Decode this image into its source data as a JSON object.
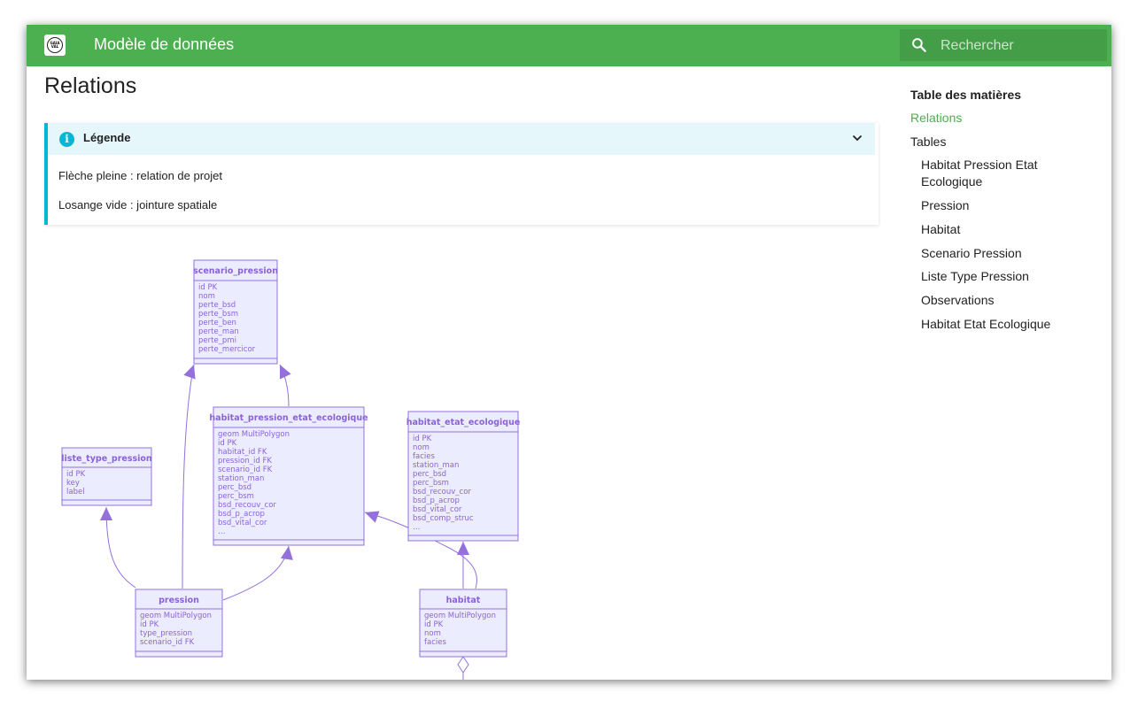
{
  "header": {
    "logo_alt": "Gaia Valley logo",
    "title": "Modèle de données",
    "search_placeholder": "Rechercher"
  },
  "page": {
    "title": "Relations"
  },
  "legend": {
    "title": "Légende",
    "lines": [
      "Flèche pleine : relation de projet",
      "Losange vide : jointure spatiale"
    ]
  },
  "toc": {
    "title": "Table des matières",
    "items": [
      {
        "label": "Relations",
        "active": true,
        "level": 0
      },
      {
        "label": "Tables",
        "active": false,
        "level": 0
      },
      {
        "label": "Habitat Pression Etat Ecologique",
        "active": false,
        "level": 1
      },
      {
        "label": "Pression",
        "active": false,
        "level": 1
      },
      {
        "label": "Habitat",
        "active": false,
        "level": 1
      },
      {
        "label": "Scenario Pression",
        "active": false,
        "level": 1
      },
      {
        "label": "Liste Type Pression",
        "active": false,
        "level": 1
      },
      {
        "label": "Observations",
        "active": false,
        "level": 1
      },
      {
        "label": "Habitat Etat Ecologique",
        "active": false,
        "level": 1
      }
    ]
  },
  "diagram": {
    "colors": {
      "header": "#4caf50",
      "entity_fill": "#ececff",
      "entity_stroke": "#9370db",
      "text": "#8a62d6",
      "info": "#00b8d4"
    },
    "entities": [
      {
        "id": "scenario_pression",
        "name": "scenario_pression",
        "attributes": [
          "id PK",
          "nom",
          "perte_bsd",
          "perte_bsm",
          "perte_ben",
          "perte_man",
          "perte_pmi",
          "perte_mercicor"
        ]
      },
      {
        "id": "habitat_pression_etat_ecologique",
        "name": "habitat_pression_etat_ecologique",
        "attributes": [
          "geom MultiPolygon",
          "id PK",
          "habitat_id FK",
          "pression_id FK",
          "scenario_id FK",
          "station_man",
          "perc_bsd",
          "perc_bsm",
          "bsd_recouv_cor",
          "bsd_p_acrop",
          "bsd_vital_cor",
          "..."
        ]
      },
      {
        "id": "habitat_etat_ecologique",
        "name": "habitat_etat_ecologique",
        "attributes": [
          "id PK",
          "nom",
          "facies",
          "station_man",
          "perc_bsd",
          "perc_bsm",
          "bsd_recouv_cor",
          "bsd_p_acrop",
          "bsd_vital_cor",
          "bsd_comp_struc",
          "..."
        ]
      },
      {
        "id": "liste_type_pression",
        "name": "liste_type_pression",
        "attributes": [
          "id PK",
          "key",
          "label"
        ]
      },
      {
        "id": "pression",
        "name": "pression",
        "attributes": [
          "geom MultiPolygon",
          "id PK",
          "type_pression",
          "scenario_id FK"
        ]
      },
      {
        "id": "habitat",
        "name": "habitat",
        "attributes": [
          "geom MultiPolygon",
          "id PK",
          "nom",
          "facies"
        ]
      }
    ],
    "relations": [
      {
        "from": "habitat_pression_etat_ecologique",
        "to": "scenario_pression",
        "kind": "arrow"
      },
      {
        "from": "pression",
        "to": "scenario_pression",
        "kind": "arrow"
      },
      {
        "from": "pression",
        "to": "liste_type_pression",
        "kind": "arrow"
      },
      {
        "from": "pression",
        "to": "habitat_pression_etat_ecologique",
        "kind": "arrow"
      },
      {
        "from": "habitat",
        "to": "habitat_pression_etat_ecologique",
        "kind": "arrow"
      },
      {
        "from": "habitat",
        "to": "habitat_etat_ecologique",
        "kind": "arrow"
      },
      {
        "from": "habitat",
        "to": "observations",
        "kind": "diamond"
      }
    ]
  }
}
